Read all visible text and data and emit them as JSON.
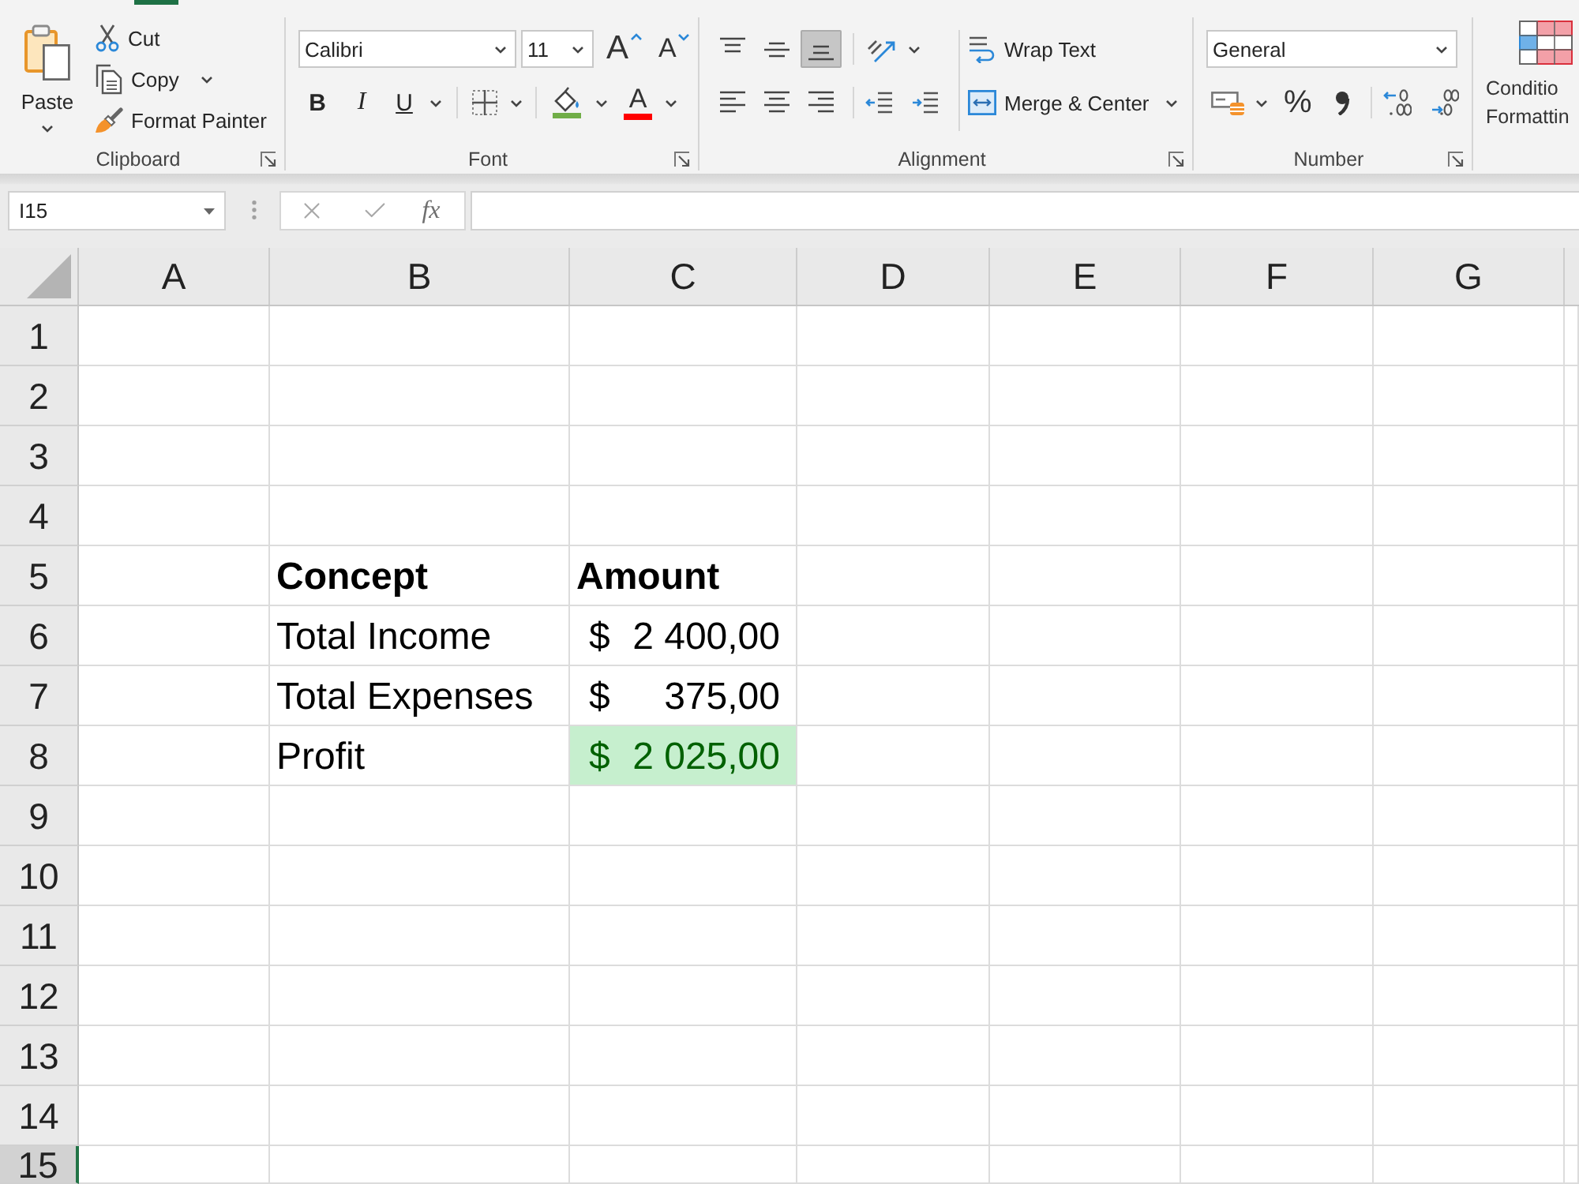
{
  "ribbon": {
    "clipboard": {
      "paste": "Paste",
      "cut": "Cut",
      "copy": "Copy",
      "format_painter": "Format Painter",
      "label": "Clipboard"
    },
    "font": {
      "font_name": "Calibri",
      "font_size": "11",
      "grow_font": "A",
      "shrink_font": "A",
      "bold": "B",
      "italic": "I",
      "underline": "U",
      "font_color": "A",
      "label": "Font"
    },
    "alignment": {
      "vertical": [
        {
          "kind": "top",
          "selected": false
        },
        {
          "kind": "middle",
          "selected": false
        },
        {
          "kind": "bottom",
          "selected": true
        }
      ],
      "horizontal": [
        {
          "kind": "left",
          "selected": false
        },
        {
          "kind": "center",
          "selected": false
        },
        {
          "kind": "right",
          "selected": false
        }
      ],
      "wrap_text": "Wrap Text",
      "merge_center": "Merge & Center",
      "label": "Alignment"
    },
    "number": {
      "format": "General",
      "percent": "%",
      "label": "Number"
    },
    "styles": {
      "conditional_formatting": [
        "Conditio",
        "Formattin"
      ]
    }
  },
  "formula_bar": {
    "name_box": "I15",
    "function_label": "fx"
  },
  "sheet": {
    "columns": [
      "A",
      "B",
      "C",
      "D",
      "E",
      "F",
      "G"
    ],
    "rows": [
      {
        "number": "1",
        "selected": false
      },
      {
        "number": "2",
        "selected": false
      },
      {
        "number": "3",
        "selected": false
      },
      {
        "number": "4",
        "selected": false
      },
      {
        "number": "5",
        "selected": false
      },
      {
        "number": "6",
        "selected": false
      },
      {
        "number": "7",
        "selected": false
      },
      {
        "number": "8",
        "selected": false
      },
      {
        "number": "9",
        "selected": false
      },
      {
        "number": "10",
        "selected": false
      },
      {
        "number": "11",
        "selected": false
      },
      {
        "number": "12",
        "selected": false
      },
      {
        "number": "13",
        "selected": false
      },
      {
        "number": "14",
        "selected": false
      },
      {
        "number": "15",
        "selected": true
      }
    ],
    "table": {
      "columns": [
        "Concept",
        "Amount"
      ],
      "rows": [
        {
          "concept": "Total Income",
          "currency": "$",
          "amount": "2 400,00",
          "highlighted": false
        },
        {
          "concept": "Total Expenses",
          "currency": "$",
          "amount": "375,00",
          "highlighted": false
        },
        {
          "concept": "Profit",
          "currency": "$",
          "amount": "2 025,00",
          "highlighted": true
        }
      ]
    }
  }
}
